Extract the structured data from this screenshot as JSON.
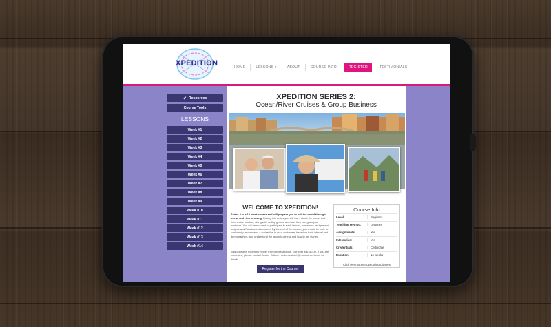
{
  "site": {
    "logo_text": "XPEDITION",
    "nav": [
      "HOME",
      "LESSONS ▾",
      "ABOUT",
      "COURSE INFO",
      "REGISTER",
      "TESTIMONIALS"
    ]
  },
  "sidebar": {
    "resources_label": "Resources",
    "course_tools_label": "Course Tools",
    "lessons_title": "LESSONS",
    "weeks": [
      "Week #1",
      "Week #2",
      "Week #3",
      "Week #4",
      "Week #5",
      "Week #6",
      "Week #7",
      "Week #8",
      "Week #9",
      "Week #10",
      "Week #11",
      "Week #12",
      "Week #13",
      "Week #14"
    ]
  },
  "main": {
    "title": "XPEDITION SERIES 2:",
    "subtitle": "Ocean/River Cruises & Group Business",
    "welcome": "WELCOME TO XPEDITION!",
    "intro_bold": "Series 2 is a 14-week course and will prepare you to sell the world through ocean and river cruising.",
    "intro_rest": " During this series you will learn about the ocean and river cruise product, along with selling groups and how they can grow your business. You will be required to participate in each lesson, homework assignment, project, and Facebook discussion. By the end of the course, you should be able to confidently recommend a cruise line to your customers based on their interest and demographics, and understand the group business and how to get started.",
    "para2": "This course is meant for newer travel professionals. The cost is $150.00. If you are interested, please contact Amber Zalkert - amber.zalkert@mundotravel.com for details.",
    "cta_label": "Register for the Course!"
  },
  "course_info": {
    "title": "Course Info",
    "rows": [
      {
        "k": "Level:",
        "v": "Beginner"
      },
      {
        "k": "Teaching Method:",
        "v": "Lectures"
      },
      {
        "k": "Assignments:",
        "v": "Yes"
      },
      {
        "k": "Interactive:",
        "v": "Yes"
      },
      {
        "k": "Credentials:",
        "v": "Certificate"
      },
      {
        "k": "Duration:",
        "v": "14 weeks"
      }
    ],
    "link": "Click Here to See Upcoming Classes"
  },
  "colors": {
    "accent": "#d91882",
    "sidebar": "#8b84c9",
    "button": "#3a3672"
  }
}
